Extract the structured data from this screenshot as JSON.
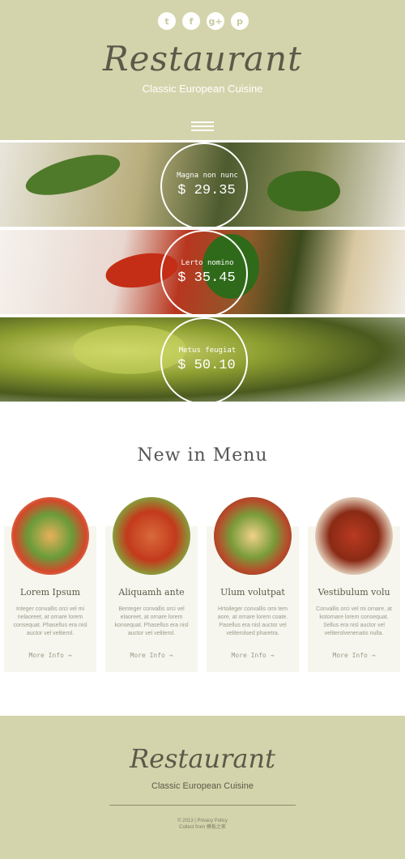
{
  "header": {
    "logo": "Restaurant",
    "tagline": "Classic European Cuisine",
    "social": [
      {
        "icon": "twitter-icon",
        "glyph": "t"
      },
      {
        "icon": "facebook-icon",
        "glyph": "f"
      },
      {
        "icon": "google-plus-icon",
        "glyph": "g+"
      },
      {
        "icon": "pinterest-icon",
        "glyph": "p"
      }
    ],
    "menu_icon": "hamburger-icon"
  },
  "specials": [
    {
      "name": "Magna non nunc",
      "price": "$ 29.35"
    },
    {
      "name": "Lerto nomino",
      "price": "$ 35.45"
    },
    {
      "name": "Metus feugiat",
      "price": "$ 50.10"
    }
  ],
  "new_in_menu": {
    "title": "New in Menu",
    "cards": [
      {
        "title": "Lorem Ipsum",
        "text": "Integer convallis orci vel mi nelaoreet, at ornare lorem consequat. Phasellus era nisl auctor vel veliterol.",
        "more": "More Info →"
      },
      {
        "title": "Aliquamh ante",
        "text": "Benteger convallis orci vel elaoreet, at ornare lorem konsequat. Phasellus era nisl auctor vel veliterol.",
        "more": "More Info →"
      },
      {
        "title": "Ulum volutpat",
        "text": "Hrtoileger convallis omi tem aore, at ornare lorem coate. Pasellus era nisl auctor vel veliterolsed pharetra.",
        "more": "More Info →"
      },
      {
        "title": "Vestibulum volu",
        "text": "Convallis orci vel mi ornare, at kotornare lorem consequat. Sellus era nisl auctor vel veliterolvenenatis nulla.",
        "more": "More Info →"
      }
    ]
  },
  "footer": {
    "logo": "Restaurant",
    "tagline": "Classic European Cuisine",
    "copyright": "© 2013 | Privacy Policy",
    "collect": "Collect from 模板之家"
  },
  "colors": {
    "accent": "#d4d4ac",
    "text": "#5a5a4a"
  }
}
